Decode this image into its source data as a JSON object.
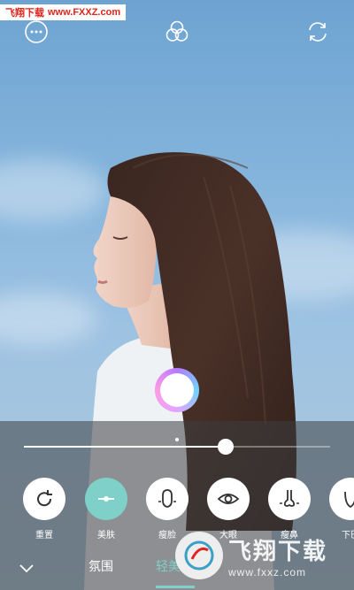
{
  "watermark_top": {
    "cn": "飞翔下载",
    "url": "www.FXXZ.com"
  },
  "top_bar": {
    "more_icon": "more-icon",
    "filter_icon": "filter-circles-icon",
    "switch_camera_icon": "switch-camera-icon"
  },
  "slider": {
    "value": 0.66,
    "default_mark": 0.5
  },
  "tools": [
    {
      "label": "重置",
      "icon": "reset-icon",
      "active": false
    },
    {
      "label": "美肤",
      "icon": "skin-slider-icon",
      "active": true
    },
    {
      "label": "瘦脸",
      "icon": "slim-face-icon",
      "active": false
    },
    {
      "label": "大眼",
      "icon": "eye-icon",
      "active": false
    },
    {
      "label": "瘦鼻",
      "icon": "nose-icon",
      "active": false
    },
    {
      "label": "下巴",
      "icon": "chin-icon",
      "active": false
    }
  ],
  "tabs": [
    {
      "label": "氛围",
      "active": false
    },
    {
      "label": "轻美",
      "active": true
    }
  ],
  "watermark_bottom": {
    "big": "飞翔下载",
    "small": "www.fxxz.com"
  },
  "colors": {
    "accent": "#7fd0c8",
    "watermark_red": "#e0241b"
  }
}
